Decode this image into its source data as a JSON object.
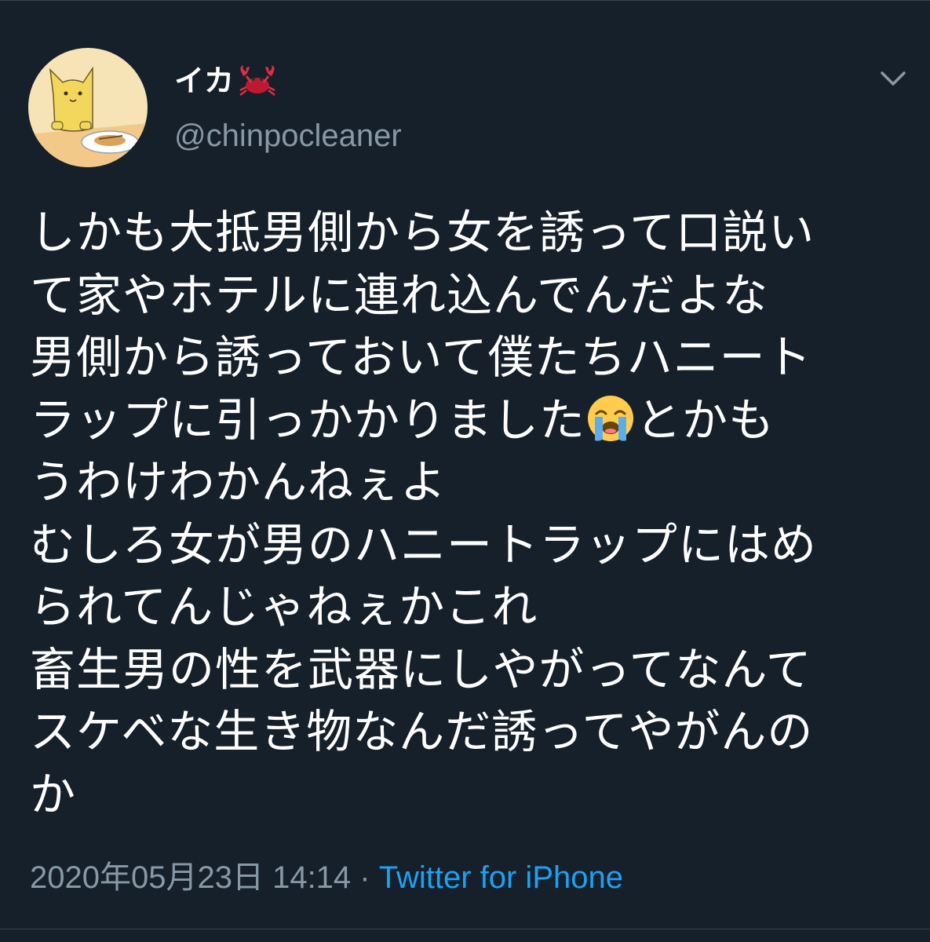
{
  "tweet": {
    "display_name": "イカ",
    "name_emoji": "crab-emoji",
    "handle": "@chinpocleaner",
    "body_lines": [
      "しかも大抵男側から女を誘って口説い",
      "て家やホテルに連れ込んでんだよな",
      "男側から誘っておいて僕たちハニート",
      "ラップに引っかかりました",
      "とかも",
      "うわけわかんねぇよ",
      "むしろ女が男のハニートラップにはめ",
      "られてんじゃねぇかこれ",
      "畜生男の性を武器にしやがってなんて",
      "スケベな生き物なんだ誘ってやがんの",
      "か"
    ],
    "timestamp": "2020年05月23日 14:14",
    "separator": " · ",
    "source": "Twitter for iPhone"
  },
  "colors": {
    "background": "#15202b",
    "text": "#ffffff",
    "muted": "#8899a6",
    "link": "#1da1f2",
    "border": "#38444d"
  },
  "icons": {
    "caret": "chevron-down-icon",
    "emoji": "loudly-crying-face-emoji"
  }
}
